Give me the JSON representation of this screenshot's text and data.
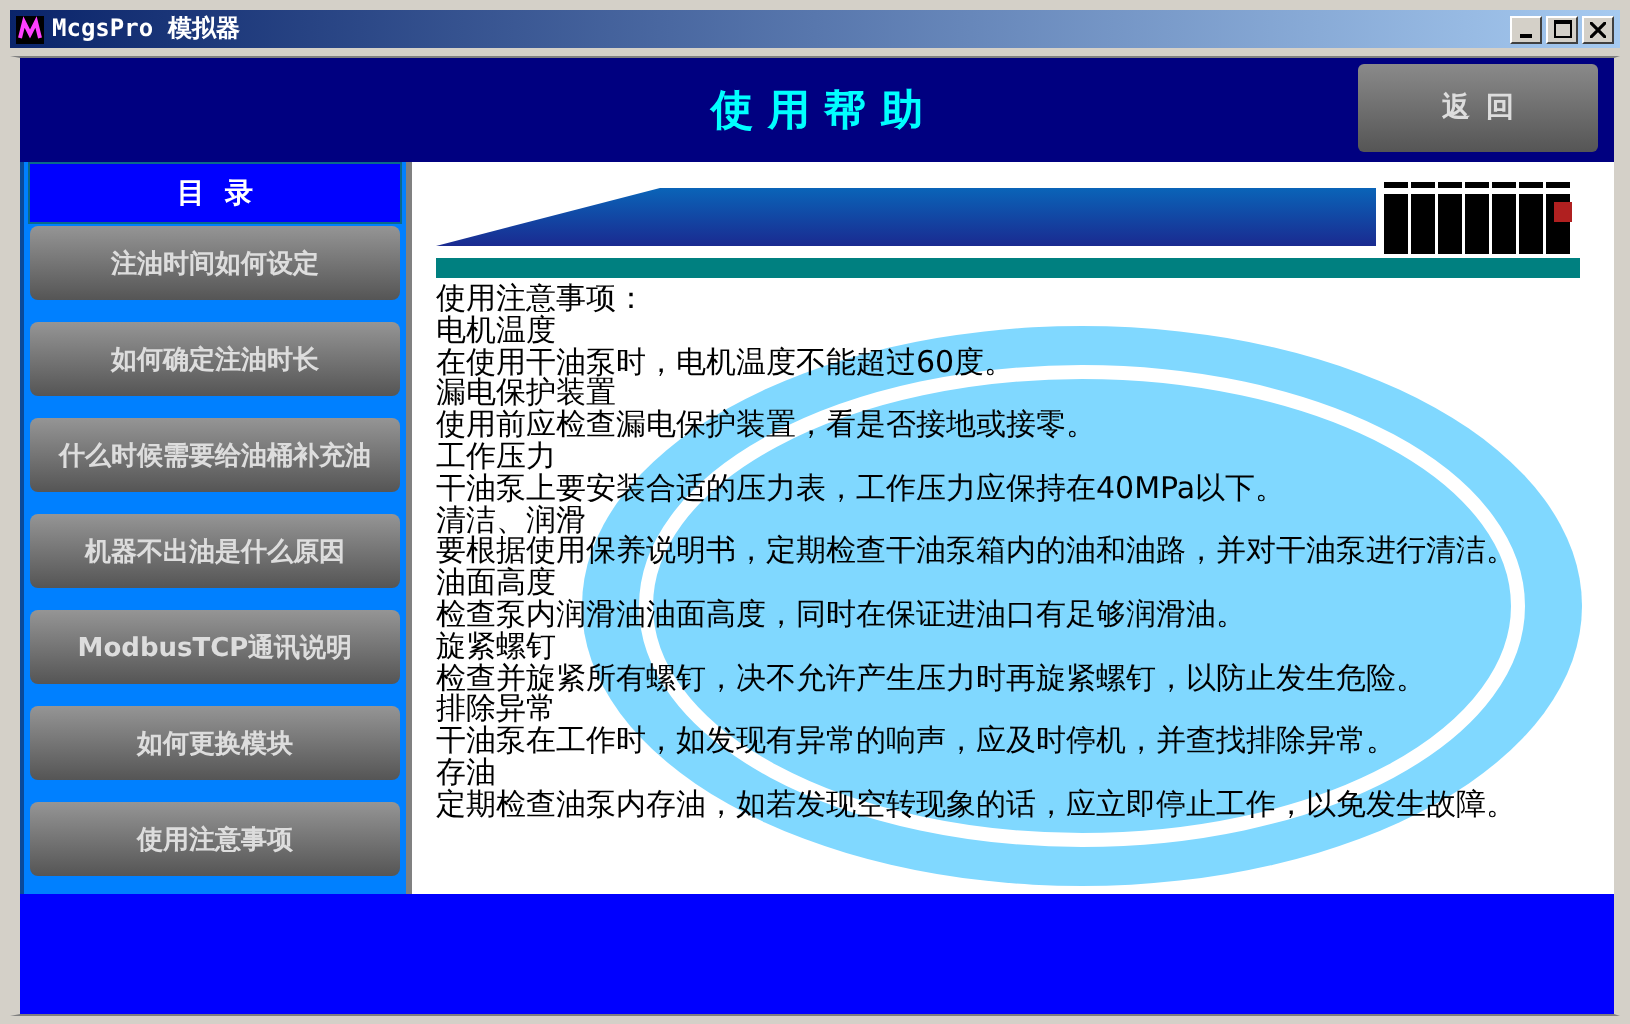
{
  "window": {
    "title": "McgsPro 模拟器"
  },
  "header": {
    "title": "使 用 帮 助",
    "back_button": "返  回"
  },
  "sidebar": {
    "title": "目  录",
    "items": [
      {
        "label": "注油时间如何设定"
      },
      {
        "label": "如何确定注油时长"
      },
      {
        "label": "什么时候需要给油桶补充油"
      },
      {
        "label": "机器不出油是什么原因"
      },
      {
        "label": "ModbusTCP通讯说明"
      },
      {
        "label": "如何更换模块"
      },
      {
        "label": "使用注意事项"
      }
    ]
  },
  "content": {
    "heading": "使用注意事项：",
    "sections": [
      {
        "title": "电机温度",
        "body": "在使用干油泵时，电机温度不能超过60度。"
      },
      {
        "title": "漏电保护装置",
        "body": "使用前应检查漏电保护装置，看是否接地或接零。"
      },
      {
        "title": "工作压力",
        "body": "干油泵上要安装合适的压力表，工作压力应保持在40MPa以下。"
      },
      {
        "title": "清洁、润滑",
        "body": "要根据使用保养说明书，定期检查干油泵箱内的油和油路，并对干油泵进行清洁。"
      },
      {
        "title": "油面高度",
        "body": "检查泵内润滑油油面高度，同时在保证进油口有足够润滑油。"
      },
      {
        "title": "旋紧螺钉",
        "body": "检查并旋紧所有螺钉，决不允许产生压力时再旋紧螺钉，以防止发生危险。"
      },
      {
        "title": "排除异常",
        "body": "干油泵在工作时，如发现有异常的响声，应及时停机，并查找排除异常。"
      },
      {
        "title": "存油",
        "body": "定期检查油泵内存油，如若发现空转现象的话，应立即停止工作，以免发生故障。"
      }
    ]
  }
}
